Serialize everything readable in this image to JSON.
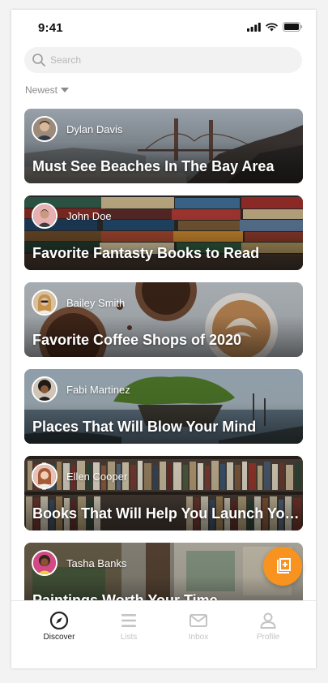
{
  "status_bar": {
    "time": "9:41"
  },
  "search": {
    "placeholder": "Search"
  },
  "sort": {
    "label": "Newest"
  },
  "cards": [
    {
      "author": "Dylan Davis",
      "title": "Must See Beaches In The Bay Area"
    },
    {
      "author": "John Doe",
      "title": "Favorite Fantasty Books to Read"
    },
    {
      "author": "Bailey Smith",
      "title": "Favorite Coffee Shops of 2020"
    },
    {
      "author": "Fabi Martinez",
      "title": "Places That Will Blow Your Mind"
    },
    {
      "author": "Ellen Cooper",
      "title": "Books That Will Help You Launch Your Career"
    },
    {
      "author": "Tasha Banks",
      "title": "Paintings Worth Your Time"
    }
  ],
  "tabs": [
    {
      "label": "Discover",
      "icon": "compass-icon",
      "active": true
    },
    {
      "label": "Lists",
      "icon": "list-icon",
      "active": false
    },
    {
      "label": "Inbox",
      "icon": "mail-icon",
      "active": false
    },
    {
      "label": "Profile",
      "icon": "user-icon",
      "active": false
    }
  ],
  "colors": {
    "accent": "#f7931e",
    "active_tab": "#222222",
    "inactive_tab": "#c4c4c4"
  }
}
